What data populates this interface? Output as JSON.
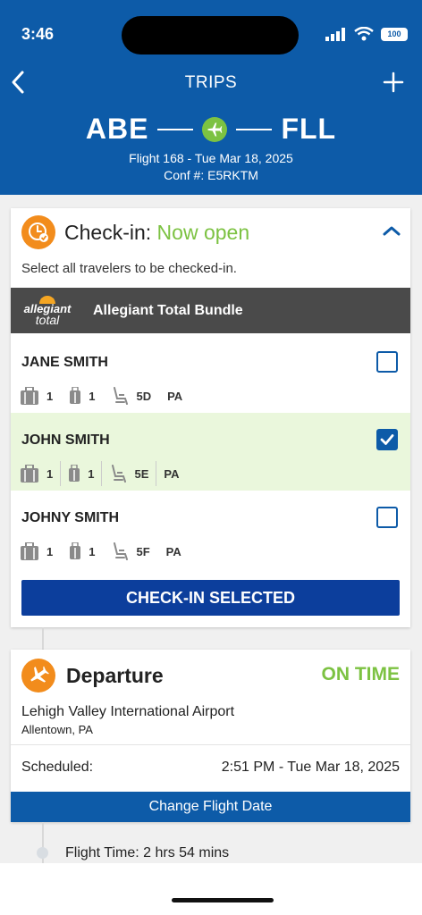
{
  "status_bar": {
    "time": "3:46",
    "battery": "100"
  },
  "nav": {
    "title": "TRIPS"
  },
  "trip": {
    "origin": "ABE",
    "destination": "FLL",
    "flight_line": "Flight 168 - Tue Mar 18, 2025",
    "conf_line": "Conf #: E5RKTM"
  },
  "checkin": {
    "title": "Check-in:",
    "status": "Now open",
    "instruction": "Select all travelers to be checked-in.",
    "bundle_logo_top": "allegiant",
    "bundle_logo_bottom": "total",
    "bundle_label": "Allegiant Total Bundle",
    "travelers": [
      {
        "name": "JANE SMITH",
        "bags": "1",
        "carryon": "1",
        "seat": "5D",
        "code": "PA",
        "checked": false
      },
      {
        "name": "JOHN SMITH",
        "bags": "1",
        "carryon": "1",
        "seat": "5E",
        "code": "PA",
        "checked": true
      },
      {
        "name": "JOHNY SMITH",
        "bags": "1",
        "carryon": "1",
        "seat": "5F",
        "code": "PA",
        "checked": false
      }
    ],
    "button_label": "CHECK-IN SELECTED"
  },
  "departure": {
    "title": "Departure",
    "status": "ON TIME",
    "airport": "Lehigh Valley International Airport",
    "city": "Allentown, PA",
    "scheduled_label": "Scheduled:",
    "scheduled_value": "2:51 PM - Tue Mar 18, 2025",
    "button_label": "Change Flight Date"
  },
  "flight_time": "Flight Time: 2 hrs 54 mins",
  "colors": {
    "brand_blue": "#0d5ba8",
    "accent_green": "#7cc242",
    "accent_orange": "#f28c1c",
    "button_navy": "#0c3e9c"
  }
}
